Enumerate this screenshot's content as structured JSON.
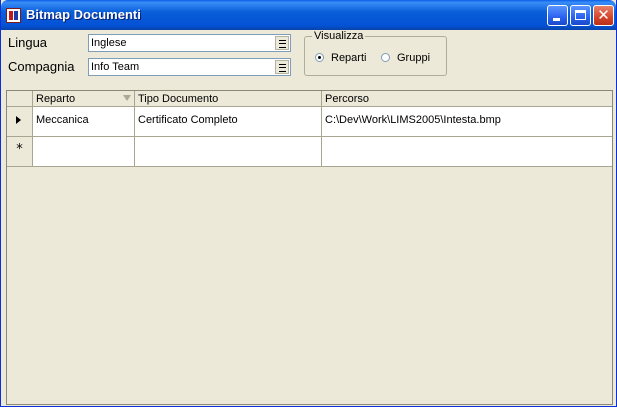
{
  "window": {
    "title": "Bitmap Documenti"
  },
  "form": {
    "lingua_label": "Lingua",
    "lingua_value": "Inglese",
    "compagnia_label": "Compagnia",
    "compagnia_value": "Info Team"
  },
  "visualizza": {
    "title": "Visualizza",
    "options": [
      {
        "label": "Reparti",
        "checked": true
      },
      {
        "label": "Gruppi",
        "checked": false
      }
    ]
  },
  "grid": {
    "columns": [
      "Reparto",
      "Tipo Documento",
      "Percorso"
    ],
    "rows": [
      {
        "reparto": "Meccanica",
        "tipo": "Certificato Completo",
        "percorso": "C:\\Dev\\Work\\LIMS2005\\Intesta.bmp"
      }
    ],
    "new_row_marker": "*"
  }
}
